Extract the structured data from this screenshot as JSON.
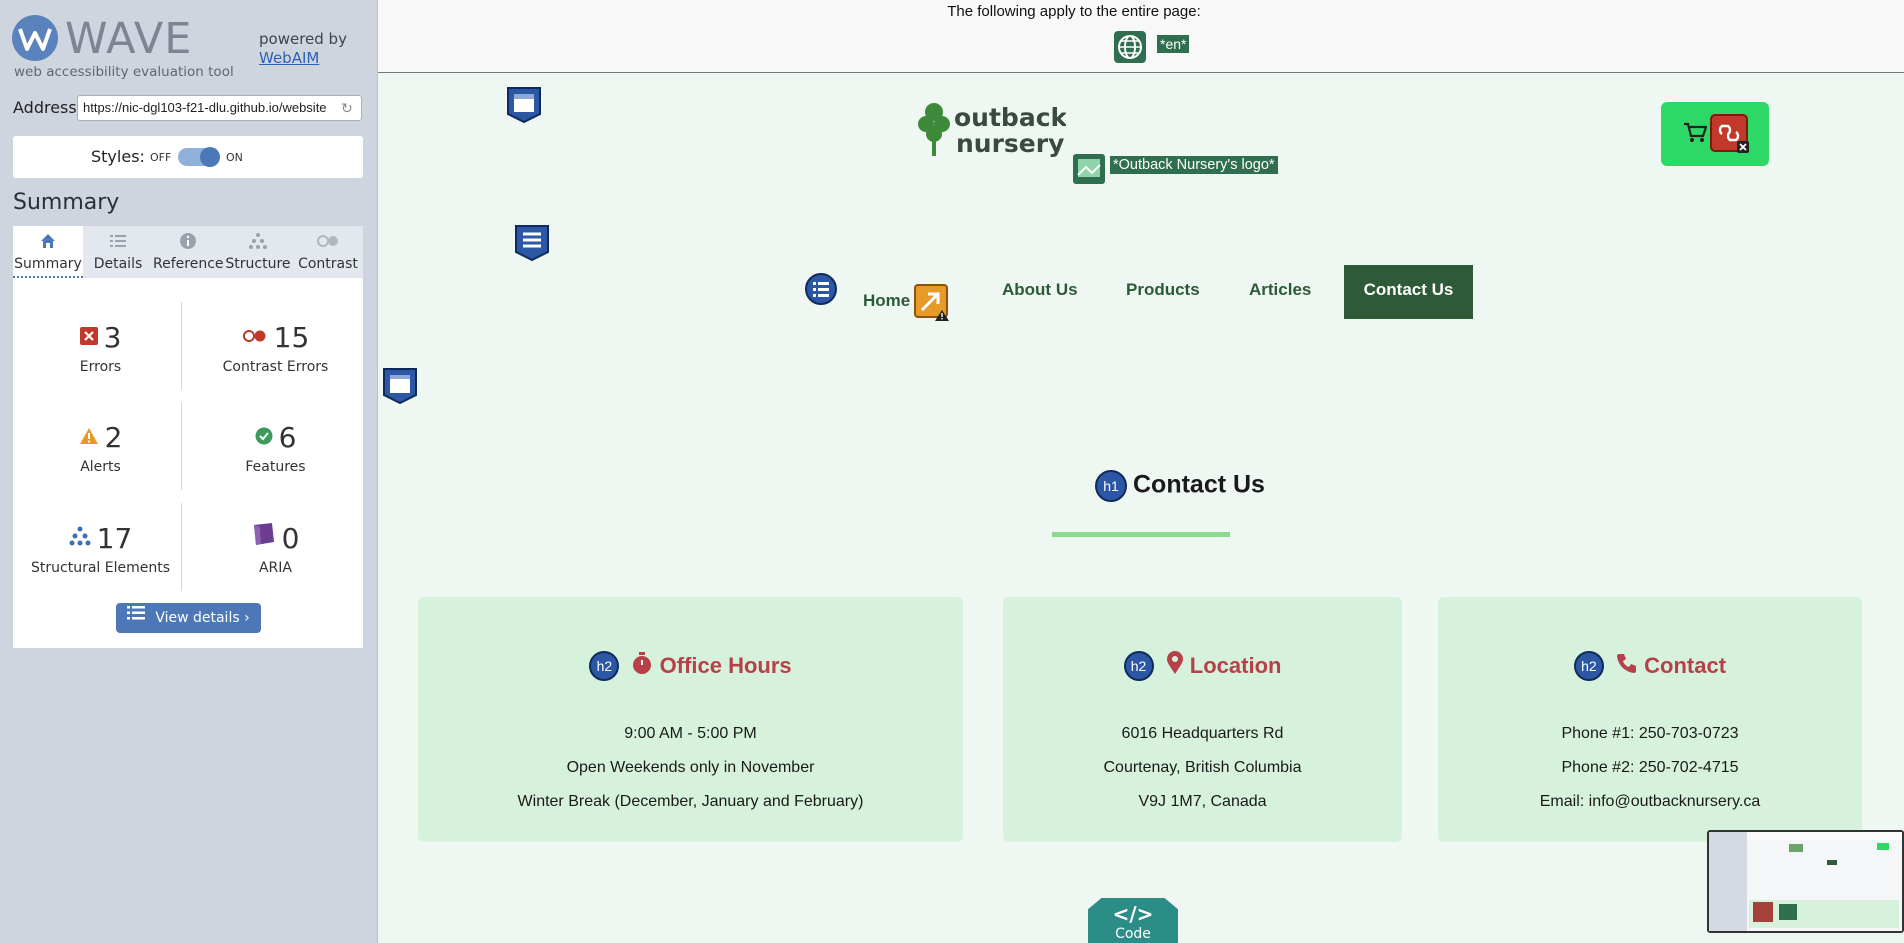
{
  "wave": {
    "brand": "WAVE",
    "subtitle": "web accessibility evaluation tool",
    "powered_by": "powered by",
    "powered_link": "WebAIM",
    "address_label": "Address:",
    "address_value": "https://nic-dgl103-f21-dlu.github.io/website",
    "styles_label": "Styles:",
    "styles_off": "OFF",
    "styles_on": "ON",
    "summary_heading": "Summary",
    "tabs": [
      {
        "label": "Summary",
        "icon": "home-icon"
      },
      {
        "label": "Details",
        "icon": "list-icon"
      },
      {
        "label": "Reference",
        "icon": "info-icon"
      },
      {
        "label": "Structure",
        "icon": "hierarchy-icon"
      },
      {
        "label": "Contrast",
        "icon": "contrast-icon"
      }
    ],
    "stats": {
      "errors": {
        "value": "3",
        "label": "Errors"
      },
      "contrast_errors": {
        "value": "15",
        "label": "Contrast Errors"
      },
      "alerts": {
        "value": "2",
        "label": "Alerts"
      },
      "features": {
        "value": "6",
        "label": "Features"
      },
      "structural": {
        "value": "17",
        "label": "Structural Elements"
      },
      "aria": {
        "value": "0",
        "label": "ARIA"
      }
    },
    "view_details": "View details ›",
    "colors": {
      "accent": "#4d78b8",
      "error": "#c0392b",
      "alert": "#e89a28",
      "feature": "#3e9a59"
    }
  },
  "page": {
    "applies_text": "The following apply to the entire page:",
    "lang_tag": "*en*",
    "logo_alt": "*Outback Nursery's logo*",
    "logo_line1": "outback",
    "logo_line2": "nursery",
    "nav": {
      "home": "Home",
      "about": "About Us",
      "products": "Products",
      "articles": "Articles",
      "contact": "Contact Us"
    },
    "h1_badge": "h1",
    "h1": "Contact Us",
    "h2_badge": "h2",
    "cards": [
      {
        "title": "Office Hours",
        "icon": "stopwatch-icon",
        "lines": [
          "9:00 AM - 5:00 PM",
          "Open Weekends only in November",
          "Winter Break (December, January and February)"
        ]
      },
      {
        "title": "Location",
        "icon": "map-pin-icon",
        "lines": [
          "6016 Headquarters Rd",
          "Courtenay, British Columbia",
          "V9J 1M7, Canada"
        ]
      },
      {
        "title": "Contact",
        "icon": "phone-icon",
        "lines": [
          "Phone #1:  250-703-0723",
          "Phone #2:  250-702-4715",
          "Email:  info@outbacknursery.ca"
        ]
      }
    ],
    "code_symbol": "</>",
    "code_label": "Code",
    "colors": {
      "bg": "#eef7f1",
      "card": "#d6f2dc",
      "nav_active": "#2f5a37",
      "title": "#b84048",
      "cart": "#2ed866"
    }
  }
}
